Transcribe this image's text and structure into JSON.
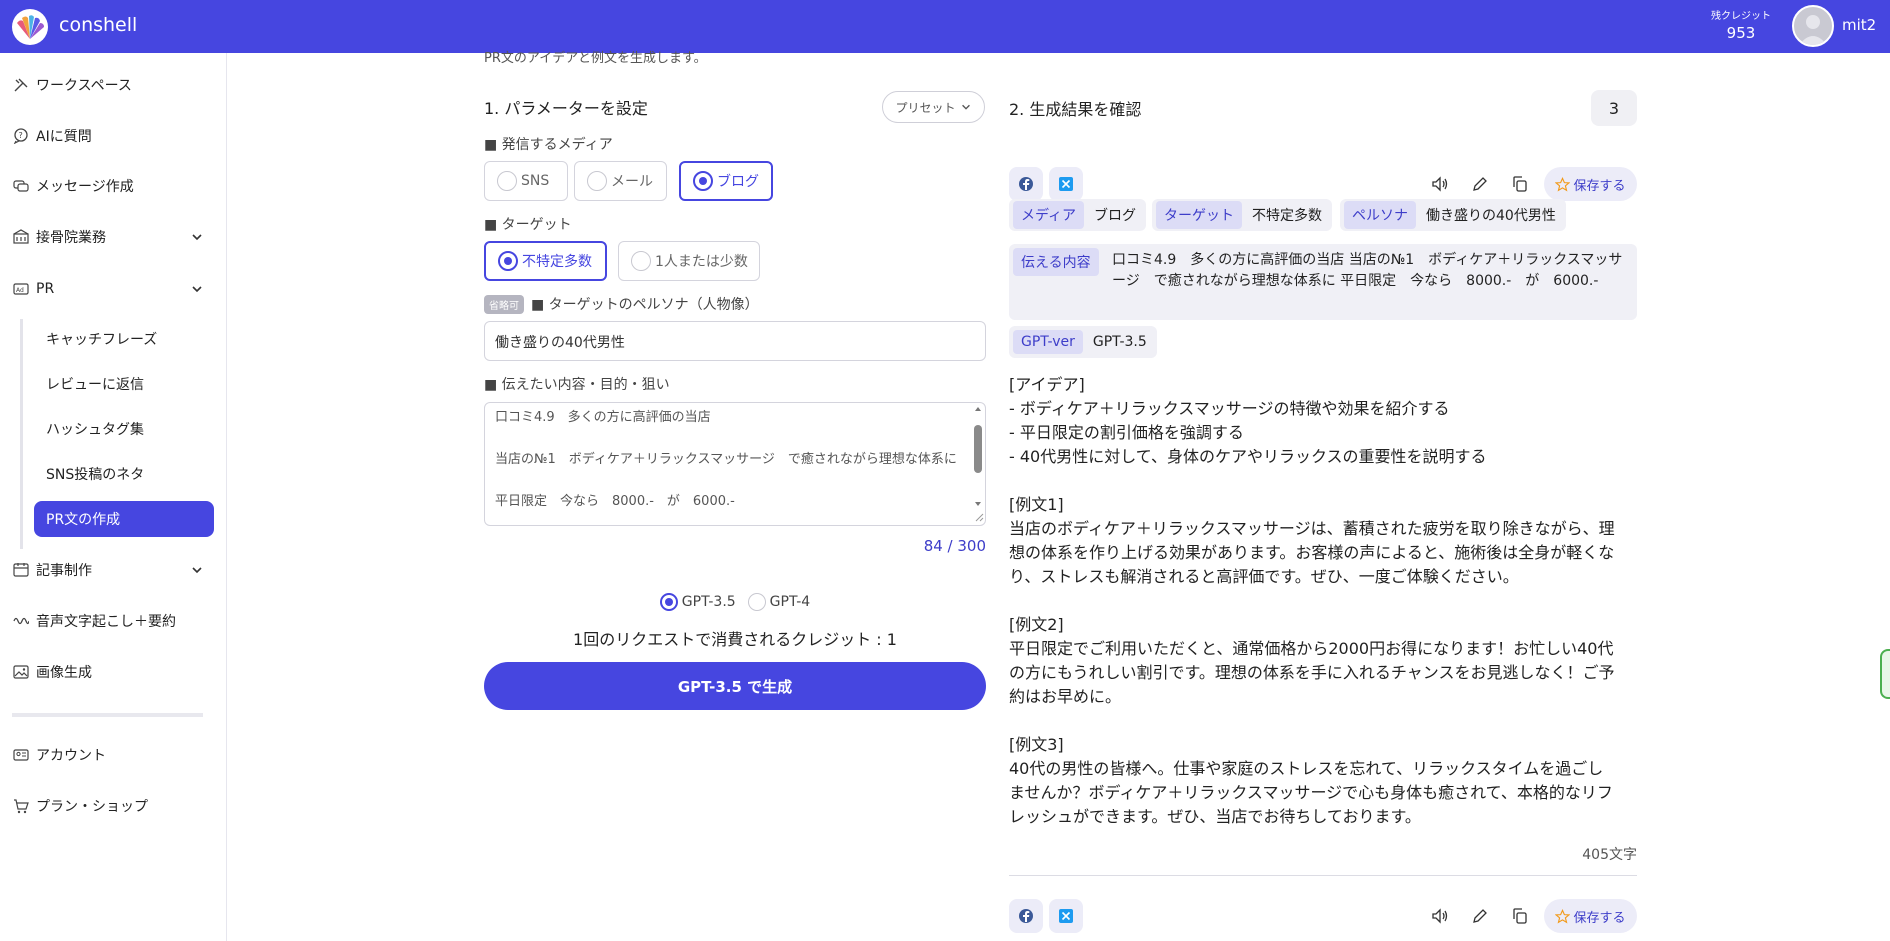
{
  "header": {
    "brand": "conshell",
    "credit_label": "残クレジット",
    "credit_value": "953",
    "username": "mit2",
    "icons": [
      "logo-icon",
      "avatar-icon"
    ]
  },
  "sidebar": {
    "items": [
      {
        "label": "ワークスペース",
        "icon": "workspace-icon"
      },
      {
        "label": "AIに質問",
        "icon": "question-icon"
      },
      {
        "label": "メッセージ作成",
        "icon": "message-icon"
      },
      {
        "label": "接骨院業務",
        "icon": "clinic-icon"
      },
      {
        "label": "PR",
        "icon": "ad-icon"
      },
      {
        "label": "記事制作",
        "icon": "calendar-icon"
      },
      {
        "label": "音声文字起こし＋要約",
        "icon": "voice-icon"
      },
      {
        "label": "画像生成",
        "icon": "image-icon"
      },
      {
        "label": "アカウント",
        "icon": "account-icon"
      },
      {
        "label": "プラン・ショップ",
        "icon": "cart-icon"
      }
    ],
    "pr_subitems": [
      {
        "label": "キャッチフレーズ"
      },
      {
        "label": "レビューに返信"
      },
      {
        "label": "ハッシュタグ集"
      },
      {
        "label": "SNS投稿のネタ"
      },
      {
        "label": "PR文の作成"
      }
    ]
  },
  "params": {
    "top_cut_text": "PR文のアイデアと例文を生成します。",
    "title": "1. パラメーターを設定",
    "preset_label": "プリセット",
    "media_label": "■ 発信するメディア",
    "media_options": [
      "SNS",
      "メール",
      "ブログ"
    ],
    "media_selected": "ブログ",
    "target_label": "■ ターゲット",
    "target_options": [
      "不特定多数",
      "1人または少数"
    ],
    "target_selected": "不特定多数",
    "optional_badge": "省略可",
    "persona_label": "■ ターゲットのペルソナ（人物像）",
    "persona_value": "働き盛りの40代男性",
    "content_label": "■ 伝えたい内容・目的・狙い",
    "content_lines": [
      "口コミ4.9　多くの方に高評価の当店",
      "",
      "当店の№1　ボディケア＋リラックスマッサージ　で癒されながら理想な体系に",
      "",
      "平日限定　今なら　8000.-　が　6000.-"
    ],
    "counter": "84 / 300",
    "models": [
      "GPT-3.5",
      "GPT-4"
    ],
    "model_selected": "GPT-3.5",
    "credit_note": "1回のリクエストで消費されるクレジット : 1",
    "generate_label": "GPT-3.5 で生成"
  },
  "results": {
    "title": "2. 生成結果を確認",
    "count": "3",
    "save_label": "保存する",
    "meta": {
      "media_key": "メディア",
      "media_value": "ブログ",
      "target_key": "ターゲット",
      "target_value": "不特定多数",
      "persona_key": "ペルソナ",
      "persona_value": "働き盛りの40代男性",
      "content_key": "伝える内容",
      "content_value": "口コミ4.9　多くの方に高評価の当店 当店の№1　ボディケア＋リラックスマッサージ　で癒されながら理想な体系に 平日限定　今なら　8000.-　が　6000.-",
      "gpt_key": "GPT-ver",
      "gpt_value": "GPT-3.5"
    },
    "text_lines": [
      "[アイデア]",
      "- ボディケア＋リラックスマッサージの特徴や効果を紹介する",
      "- 平日限定の割引価格を強調する",
      "- 40代男性に対して、身体のケアやリラックスの重要性を説明する",
      "",
      "[例文1]",
      "当店のボディケア＋リラックスマッサージは、蓄積された疲労を取り除きながら、理",
      "想の体系を作り上げる効果があります。お客様の声によると、施術後は全身が軽くな",
      "り、ストレスも解消されると高評価です。ぜひ、一度ご体験ください。",
      "",
      "[例文2]",
      "平日限定でご利用いただくと、通常価格から2000円お得になります！お忙しい40代",
      "の方にもうれしい割引です。理想の体系を手に入れるチャンスをお見逃しなく！ご予",
      "約はお早めに。",
      "",
      "[例文3]",
      "40代の男性の皆様へ。仕事や家庭のストレスを忘れて、リラックスタイムを過ごし",
      "ませんか？ボディケア＋リラックスマッサージで心も身体も癒されて、本格的なリフ",
      "レッシュができます。ぜひ、当店でお待ちしております。"
    ],
    "char_count": "405文字",
    "toolbar_icons": [
      "facebook-icon",
      "x-icon",
      "speaker-icon",
      "pencil-icon",
      "copy-icon",
      "star-icon"
    ]
  },
  "colors": {
    "accent": "#4646e0",
    "accent_soft": "#dcdcf6",
    "panel_bg": "#f0f0f6"
  }
}
